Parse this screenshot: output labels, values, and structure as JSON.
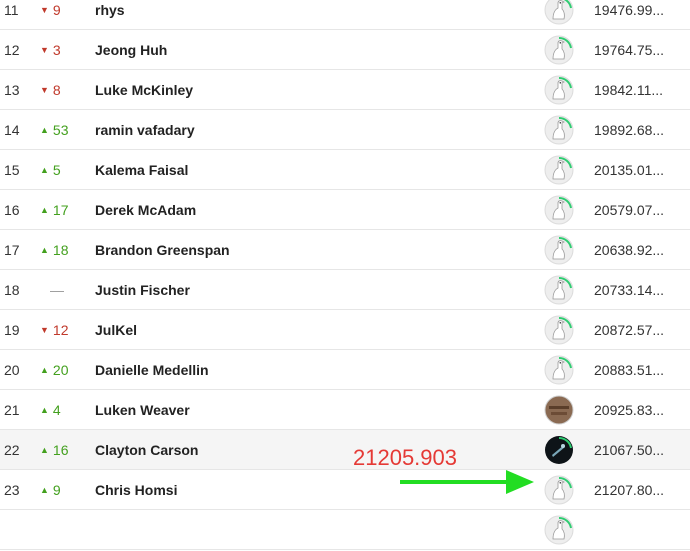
{
  "rows": [
    {
      "rank": "11",
      "direction": "down",
      "change": "9",
      "name": "rhys",
      "score": "19476.99...",
      "avatar": "goose-icon",
      "highlight": false
    },
    {
      "rank": "12",
      "direction": "down",
      "change": "3",
      "name": "Jeong Huh",
      "score": "19764.75...",
      "avatar": "goose-icon",
      "highlight": false
    },
    {
      "rank": "13",
      "direction": "down",
      "change": "8",
      "name": "Luke McKinley",
      "score": "19842.11...",
      "avatar": "goose-icon",
      "highlight": false
    },
    {
      "rank": "14",
      "direction": "up",
      "change": "53",
      "name": "ramin vafadary",
      "score": "19892.68...",
      "avatar": "goose-icon",
      "highlight": false
    },
    {
      "rank": "15",
      "direction": "up",
      "change": "5",
      "name": "Kalema Faisal",
      "score": "20135.01...",
      "avatar": "goose-icon",
      "highlight": false
    },
    {
      "rank": "16",
      "direction": "up",
      "change": "17",
      "name": "Derek McAdam",
      "score": "20579.07...",
      "avatar": "goose-icon",
      "highlight": false
    },
    {
      "rank": "17",
      "direction": "up",
      "change": "18",
      "name": "Brandon Greenspan",
      "score": "20638.92...",
      "avatar": "goose-icon",
      "highlight": false
    },
    {
      "rank": "18",
      "direction": "same",
      "change": "—",
      "name": "Justin Fischer",
      "score": "20733.14...",
      "avatar": "goose-icon",
      "highlight": false
    },
    {
      "rank": "19",
      "direction": "down",
      "change": "12",
      "name": "JulKel",
      "score": "20872.57...",
      "avatar": "goose-icon",
      "highlight": false
    },
    {
      "rank": "20",
      "direction": "up",
      "change": "20",
      "name": "Danielle Medellin",
      "score": "20883.51...",
      "avatar": "goose-icon",
      "highlight": false
    },
    {
      "rank": "21",
      "direction": "up",
      "change": "4",
      "name": "Luken Weaver",
      "score": "20925.83...",
      "avatar": "photo-avatar",
      "highlight": false
    },
    {
      "rank": "22",
      "direction": "up",
      "change": "16",
      "name": "Clayton Carson",
      "score": "21067.50...",
      "avatar": "dark-photo-avatar",
      "highlight": true
    },
    {
      "rank": "23",
      "direction": "up",
      "change": "9",
      "name": "Chris Homsi",
      "score": "21207.80...",
      "avatar": "goose-icon",
      "highlight": false
    },
    {
      "rank": "",
      "direction": "none",
      "change": "",
      "name": "",
      "score": "",
      "avatar": "goose-icon",
      "highlight": false
    }
  ],
  "annotation": {
    "text": "21205.903",
    "text_color": "#e53935",
    "arrow_color": "#22dd22"
  },
  "colors": {
    "up": "#43a01e",
    "down": "#c0392b",
    "progress_ring": "#2ecc71"
  }
}
